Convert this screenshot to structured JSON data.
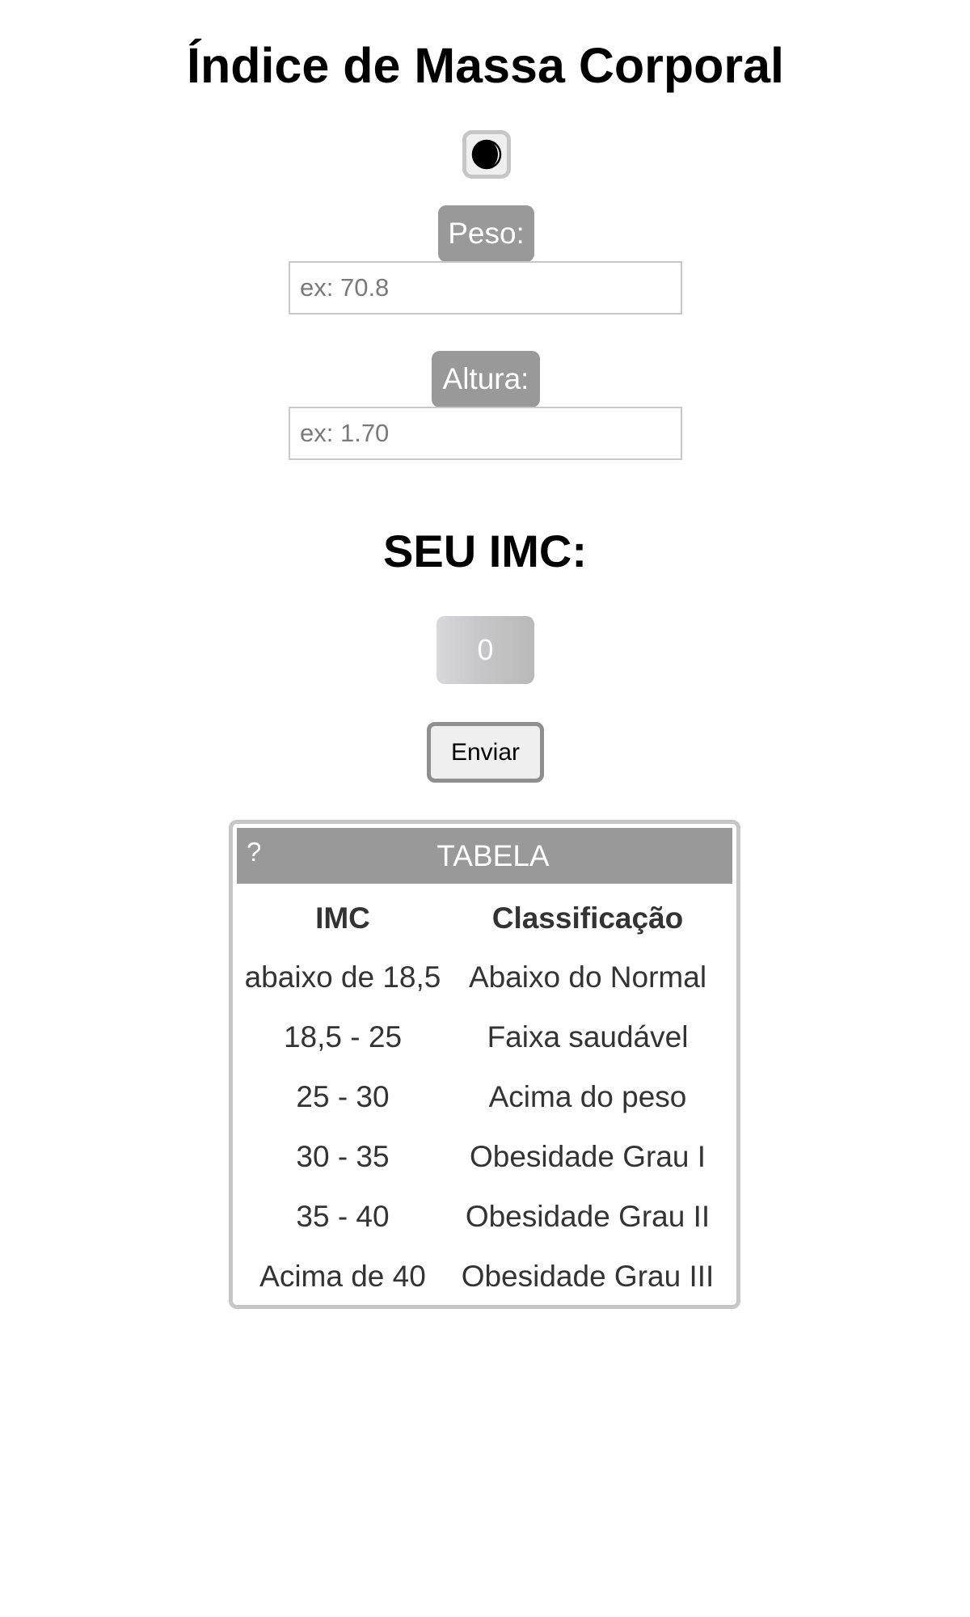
{
  "page": {
    "title": "Índice de Massa Corporal"
  },
  "theme_toggle": {
    "icon": "half-moon-icon"
  },
  "form": {
    "weight_label": "Peso:",
    "weight_placeholder": "ex: 70.8",
    "height_label": "Altura:",
    "height_placeholder": "ex: 1.70"
  },
  "result": {
    "title": "SEU IMC:",
    "value": "0"
  },
  "actions": {
    "submit_label": "Enviar"
  },
  "table": {
    "help_label": "?",
    "title": "TABELA",
    "headers": [
      "IMC",
      "Classificação"
    ],
    "rows": [
      [
        "abaixo de 18,5",
        "Abaixo do Normal"
      ],
      [
        "18,5 - 25",
        "Faixa saudável"
      ],
      [
        "25 - 30",
        "Acima do peso"
      ],
      [
        "30 - 35",
        "Obesidade Grau I"
      ],
      [
        "35 - 40",
        "Obesidade Grau II"
      ],
      [
        "Acima de 40",
        "Obesidade Grau III"
      ]
    ]
  },
  "colors": {
    "label_background": "#999999",
    "border": "#c6c6c6",
    "table_text": "#333333"
  }
}
